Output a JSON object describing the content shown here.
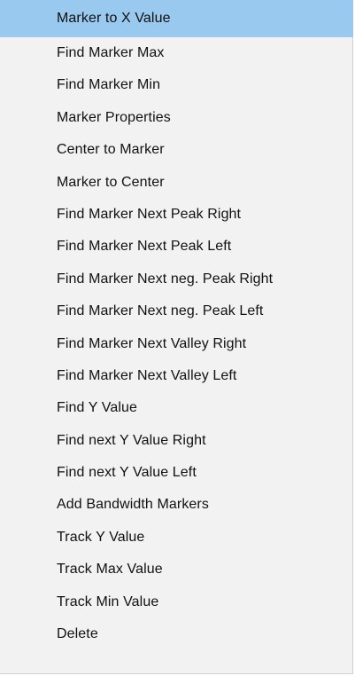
{
  "menu": {
    "items": [
      {
        "label": "Marker to X Value"
      },
      {
        "label": "Find Marker Max"
      },
      {
        "label": "Find Marker Min"
      },
      {
        "label": "Marker Properties"
      },
      {
        "label": "Center to Marker"
      },
      {
        "label": "Marker to Center"
      },
      {
        "label": "Find Marker Next Peak Right"
      },
      {
        "label": "Find Marker Next Peak Left"
      },
      {
        "label": "Find Marker Next neg. Peak Right"
      },
      {
        "label": "Find Marker Next neg. Peak Left"
      },
      {
        "label": "Find Marker Next Valley Right"
      },
      {
        "label": "Find Marker Next Valley Left"
      },
      {
        "label": "Find Y Value"
      },
      {
        "label": "Find next Y Value Right"
      },
      {
        "label": "Find next Y Value Left"
      },
      {
        "label": "Add Bandwidth Markers"
      },
      {
        "label": "Track Y Value"
      },
      {
        "label": "Track Max Value"
      },
      {
        "label": "Track Min Value"
      },
      {
        "label": "Delete"
      }
    ],
    "highlight_color": "#99c9ef",
    "background_color": "#f2f2f2"
  }
}
